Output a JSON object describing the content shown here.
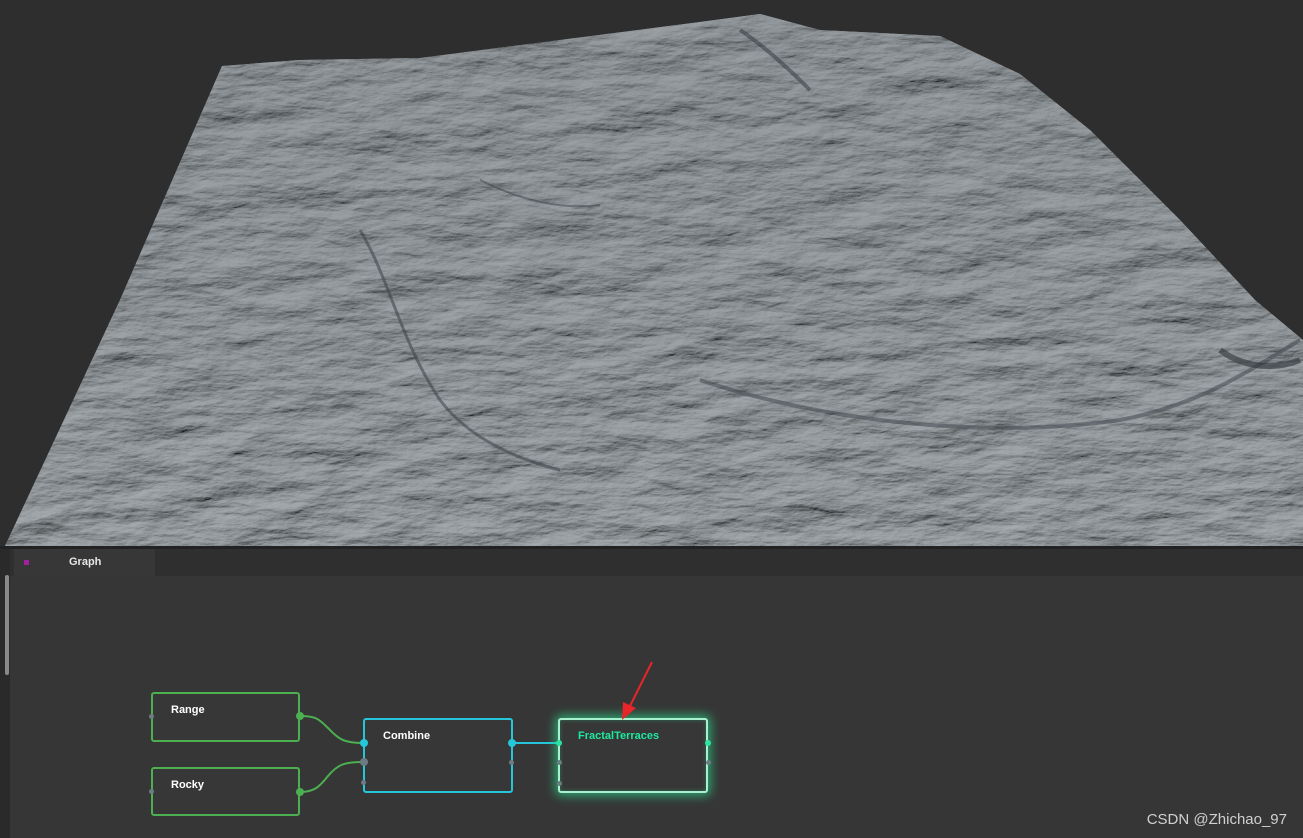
{
  "viewport": {
    "subject": "terrain-mesh"
  },
  "graph": {
    "tab_label": "Graph",
    "nodes": {
      "range": {
        "label": "Range"
      },
      "rocky": {
        "label": "Rocky"
      },
      "combine": {
        "label": "Combine"
      },
      "fractal_terraces": {
        "label": "FractalTerraces"
      }
    }
  },
  "watermark": "CSDN @Zhichao_97",
  "colors": {
    "node_green": "#4caf50",
    "node_cyan": "#26c6da",
    "node_selected_glow": "#1de9a0",
    "arrow_red": "#e8262a",
    "tab_marker": "#a020a0"
  }
}
